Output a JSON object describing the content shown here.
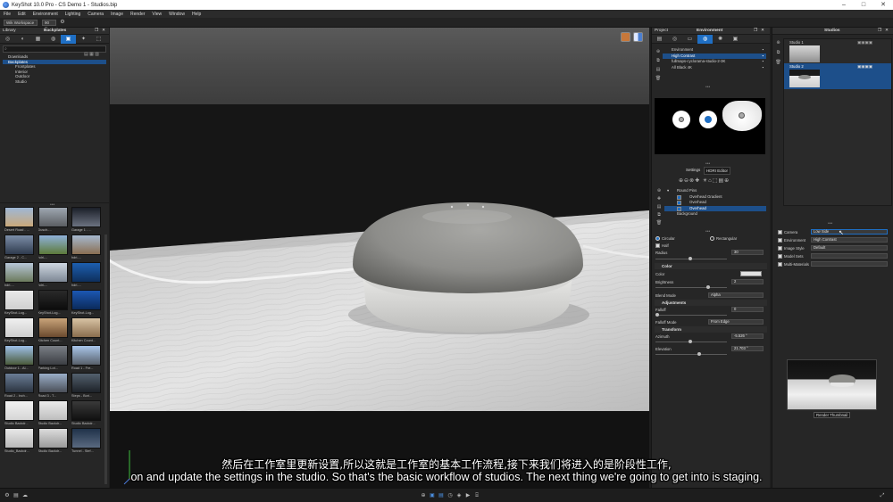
{
  "window": {
    "title": "KeyShot 10.0 Pro - CS Demo 1 - Studios.bip"
  },
  "menu": [
    "File",
    "Edit",
    "Environment",
    "Lighting",
    "Camera",
    "Image",
    "Render",
    "View",
    "Window",
    "Help"
  ],
  "toolbar": {
    "workspace": "Wik Workspace",
    "zoom": "90 %"
  },
  "library": {
    "header": "Library",
    "tab_title": "Backplates",
    "tree": [
      {
        "label": "Downloads",
        "sub": false,
        "selected": false
      },
      {
        "label": "Backplates",
        "sub": false,
        "selected": true
      },
      {
        "label": "Frontplates",
        "sub": true,
        "selected": false
      },
      {
        "label": "Interior",
        "sub": true,
        "selected": false
      },
      {
        "label": "Outdoor",
        "sub": true,
        "selected": false
      },
      {
        "label": "Studio",
        "sub": true,
        "selected": false
      }
    ],
    "thumbs": [
      "Desert Road - ...",
      "Dusch-...",
      "Garage 1 - ...",
      "Garage 2 - C...",
      "hdri-...",
      "hdri-...",
      "hdri-...",
      "hdri-...",
      "hdri-...",
      "KeyShot-Log...",
      "KeyShot-Log...",
      "KeyShot-Log...",
      "KeyShot-Log...",
      "Kitchen Count...",
      "Kitchen Count...",
      "Outdoor 1 - Al...",
      "Parking Lot...",
      "Road 1 - Fre...",
      "Road 2 - Inch...",
      "Road 3 - T...",
      "Steps - Bori...",
      "Studio Backdr...",
      "Studio Backdr...",
      "Studio Backdr...",
      "Studio_Backdr...",
      "Studio Backdr...",
      "Tunnel - Stef..."
    ]
  },
  "project": {
    "header": "Project",
    "tab_title": "Environment",
    "environments": [
      {
        "label": "Environment",
        "selected": false
      },
      {
        "label": "High Contrast",
        "selected": true
      },
      {
        "label": "fullmaps-cyclorama-studio-2-3K",
        "selected": false
      },
      {
        "label": "All Black 4K",
        "selected": false
      }
    ],
    "subtabs": {
      "settings": "Settings",
      "hdri_editor": "HDRI Editor"
    },
    "pins": [
      {
        "label": "Round Pins",
        "selected": false,
        "indent": 0
      },
      {
        "label": "Overhead Gradient",
        "selected": false,
        "indent": 1
      },
      {
        "label": "Overhead",
        "selected": false,
        "indent": 1
      },
      {
        "label": "Overhead",
        "selected": true,
        "indent": 1
      },
      {
        "label": "Background",
        "selected": false,
        "indent": 0
      }
    ],
    "shape": {
      "circular": "Circular",
      "rectangular": "Rectangular",
      "half": "Half"
    },
    "radius": {
      "label": "Radius",
      "value": "30"
    },
    "color_section": "Color",
    "color_label": "Color",
    "brightness": {
      "label": "Brightness",
      "value": "2"
    },
    "blend_mode": {
      "label": "Blend Mode",
      "value": "Alpha"
    },
    "adjustments_section": "Adjustments",
    "falloff": {
      "label": "Falloff",
      "value": "0"
    },
    "falloff_mode": {
      "label": "Falloff Mode",
      "value": "From Edge"
    },
    "transform_section": "Transform",
    "azimuth": {
      "label": "Azimuth",
      "value": "-5.526 °"
    },
    "elevation": {
      "label": "Elevation",
      "value": "21.703 °"
    }
  },
  "studios": {
    "header": "Studios",
    "items": [
      {
        "label": "Studio 1",
        "selected": false
      },
      {
        "label": "Studio 2",
        "selected": true
      }
    ],
    "settings": [
      {
        "label": "Camera",
        "value": "Low Side",
        "checked": true
      },
      {
        "label": "Environment",
        "value": "High Contrast",
        "checked": true
      },
      {
        "label": "Image Style",
        "value": "Default",
        "checked": true
      },
      {
        "label": "Model Sets",
        "value": "",
        "checked": false
      },
      {
        "label": "Multi-Materials",
        "value": "",
        "checked": false
      }
    ],
    "render_thumbnail": "Render Thumbnail"
  },
  "subtitles": {
    "cn": "然后在工作室里更新设置,所以这就是工作室的基本工作流程,接下来我们将进入的是阶段性工作,",
    "en": "on and update the settings in the studio. So that's the basic workflow of studios. The next thing we're going to get into is staging."
  },
  "colors": {
    "accent": "#1f6fc4",
    "selection": "#1d4f8a"
  }
}
